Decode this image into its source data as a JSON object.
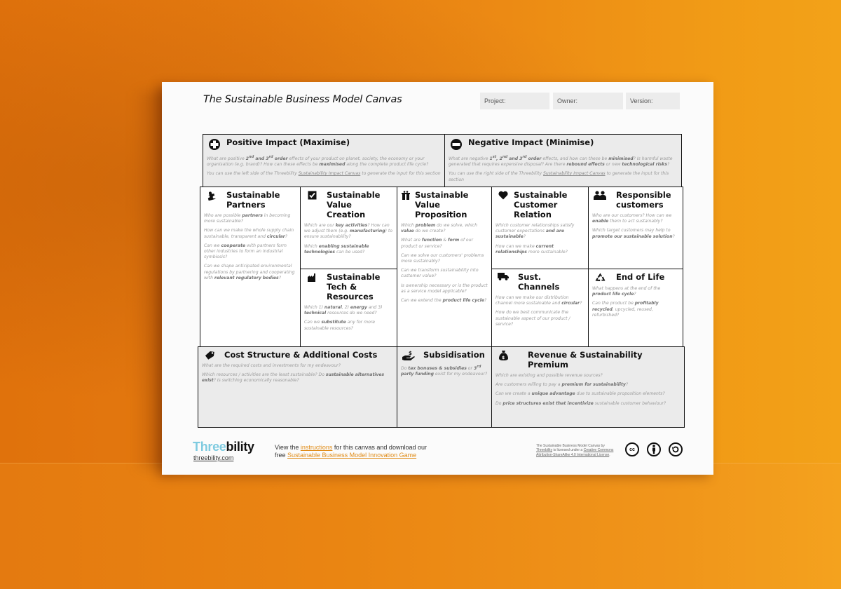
{
  "poster": {
    "title": "The Sustainable Business Model Canvas",
    "fields": [
      {
        "label": "Project:"
      },
      {
        "label": "Owner:"
      },
      {
        "label": "Version:"
      }
    ]
  },
  "blocks": {
    "positive_impact": {
      "icon": "plus-circle-icon",
      "title": "Positive Impact  (Maximise)",
      "questions": [
        "What are positive 2nd and 3rd order effects of your product on planet, society, the economy or your organisation (e.g. brand)? How can these effects be maximised along the complete product life cycle?",
        "You can use the left side of the Threebility Sustainability Impact Canvas to generate the input for this section"
      ]
    },
    "negative_impact": {
      "icon": "minus-circle-icon",
      "title": "Negative Impact  (Minimise)",
      "questions": [
        "What are negative 1st, 2nd and 3rd order effects, and how can these be minimised? Is harmful waste generated that requires expensive disposal? Are there rebound effects or new technological risks?",
        "You can use the right side of the Threebility Sustainability Impact Canvas to generate the input for this section"
      ]
    },
    "partners": {
      "icon": "puzzle-icon",
      "title": "Sustainable Partners",
      "questions": [
        "Who are possible partners in becoming more sustainable?",
        "How can we make the whole supply chain sustainable, transparent and circular?",
        "Can we cooperate with partners form other industries to form an industrial symbiosis?",
        "Can we shape anticipated environmental regulations by partnering and cooperating with relevant regulatory bodies?"
      ]
    },
    "value_creation": {
      "icon": "checkbox-icon",
      "title": "Sustainable Value Creation",
      "questions": [
        "Which are our key activities? How can we adjust them (e.g. manufacturing) to ensure sustainability?",
        "Which enabling sustainable technologies can be used?"
      ]
    },
    "tech_resources": {
      "icon": "factory-icon",
      "title": "Sustainable Tech & Resources",
      "questions": [
        "Which 1) natural, 2) energy and 3) technical resources do we need?",
        "Can we substitute any for more sustainable resources?"
      ]
    },
    "value_proposition": {
      "icon": "gift-icon",
      "title": "Sustainable Value Proposition",
      "questions": [
        "Which problem do we solve, which value do we create?",
        "What are function & form of our product or service?",
        "Can we solve our customers' problems more sustainably?",
        "Can we transform sustainability into customer value?",
        "Is ownership necessary or is the product as a service model applicable?",
        "Can we extend the product life cycle?"
      ]
    },
    "customer_relation": {
      "icon": "heart-icon",
      "title": "Sustainable Customer Relation",
      "questions": [
        "Which customer relationships satisfy customer expectations and are sustainable?",
        "How can we make current relationships more sustainable?"
      ]
    },
    "customers": {
      "icon": "people-icon",
      "title": "Responsible customers",
      "questions": [
        "Who are our customers? How can we enable them to act sustainably?",
        "Which target customers may help to promote our sustainable solution?"
      ]
    },
    "channels": {
      "icon": "truck-icon",
      "title": "Sust. Channels",
      "questions": [
        "How can we make our distribution channel more sustainable and circular?",
        "How do we best communicate the sustainable aspect of our product / service?"
      ]
    },
    "end_of_life": {
      "icon": "recycle-icon",
      "title": "End of Life",
      "questions": [
        "What happens at the end of the product life cycle?",
        "Can the product be profitably recycled, upcycled, reused, refurbished?"
      ]
    },
    "cost_structure": {
      "icon": "tag-icon",
      "title": "Cost Structure & Additional Costs",
      "questions": [
        "What are the required costs and investments for my endeavour?",
        "Which resources / activities are the least sustainable? Do sustainable alternatives exist? Is switching economically reasonable?"
      ]
    },
    "subsidisation": {
      "icon": "hand-money-icon",
      "title": "Subsidisation",
      "questions": [
        "Do tax bonuses & subsidies or 3rd party funding exist for my endeavour?"
      ]
    },
    "revenue": {
      "icon": "money-bag-icon",
      "title": "Revenue & Sustainability Premium",
      "questions": [
        "Which are existing and possible revenue sources?",
        "Are customers willing to pay a premium for sustainability?",
        "Can we create a unique advantage due to sustainable proposition elements?",
        "Do price structures exist that incentivize sustainable customer behaviour?"
      ]
    }
  },
  "footer": {
    "logo_part1": "Three",
    "logo_part2": "bility",
    "url": "threebility.com",
    "text_1": "View the ",
    "link_instructions": "instructions",
    "text_2": " for this canvas and download our",
    "text_3": "free ",
    "link_game": "Sustainable Business Model Innovation Game",
    "license_1": "The Sustainable Business Model Canvas by",
    "license_link_author": "Threebility",
    "license_2": " is licensed under a ",
    "license_link_cc": "Creative Commons Attribution-ShareAlike 4.0 International License",
    "license_3": ".",
    "cc_badges": [
      "cc",
      "by",
      "sa"
    ]
  },
  "colors": {
    "background_orange": "#ec8a14",
    "logo_blue": "#7fcbe0",
    "link_orange": "#e08b16",
    "impact_grey": "#ebebeb"
  }
}
